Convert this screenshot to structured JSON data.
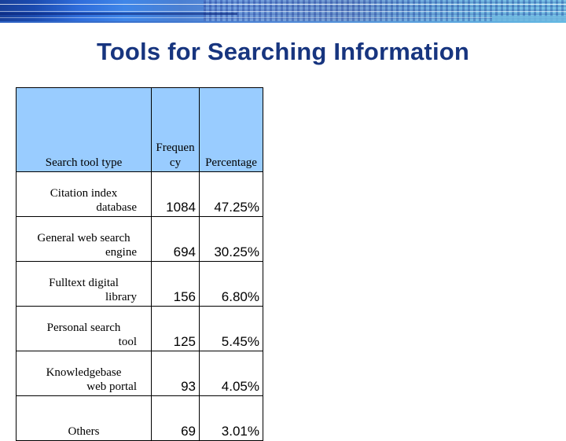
{
  "slide": {
    "title": "Tools for Searching Information"
  },
  "theme": {
    "title_color": "#17357F",
    "header_fill": "#99CCFF",
    "banner_dark_blue": "#18409A",
    "banner_light_blue": "#63B9E2",
    "border_color": "#000000"
  },
  "table": {
    "columns": [
      {
        "key": "search_tool_type",
        "label": "Search tool type"
      },
      {
        "key": "frequency",
        "label": "Frequency"
      },
      {
        "key": "percentage",
        "label": "Percentage"
      }
    ],
    "header_wrapped": {
      "frequency_lines": [
        "Freq",
        "ue",
        "nc",
        "y"
      ],
      "percentage_lines": [
        "Percent",
        "age"
      ]
    },
    "rows": [
      {
        "label": "Citation index database",
        "label_lines": [
          "Citation index",
          "database"
        ],
        "frequency": "1084",
        "percentage": "47.25%"
      },
      {
        "label": "General web search engine",
        "label_lines": [
          "General web search",
          "engine"
        ],
        "frequency": "694",
        "percentage": "30.25%"
      },
      {
        "label": "Fulltext digital library",
        "label_lines": [
          "Fulltext digital",
          "library"
        ],
        "frequency": "156",
        "percentage": "6.80%"
      },
      {
        "label": "Personal search tool",
        "label_lines": [
          "Personal search",
          "tool"
        ],
        "frequency": "125",
        "percentage": "5.45%"
      },
      {
        "label": "Knowledgebase web portal",
        "label_lines": [
          "Knowledgebase",
          "web portal"
        ],
        "frequency": "93",
        "percentage": "4.05%"
      },
      {
        "label": "Others",
        "label_lines": [
          "Others",
          ""
        ],
        "frequency": "69",
        "percentage": "3.01%"
      }
    ]
  }
}
